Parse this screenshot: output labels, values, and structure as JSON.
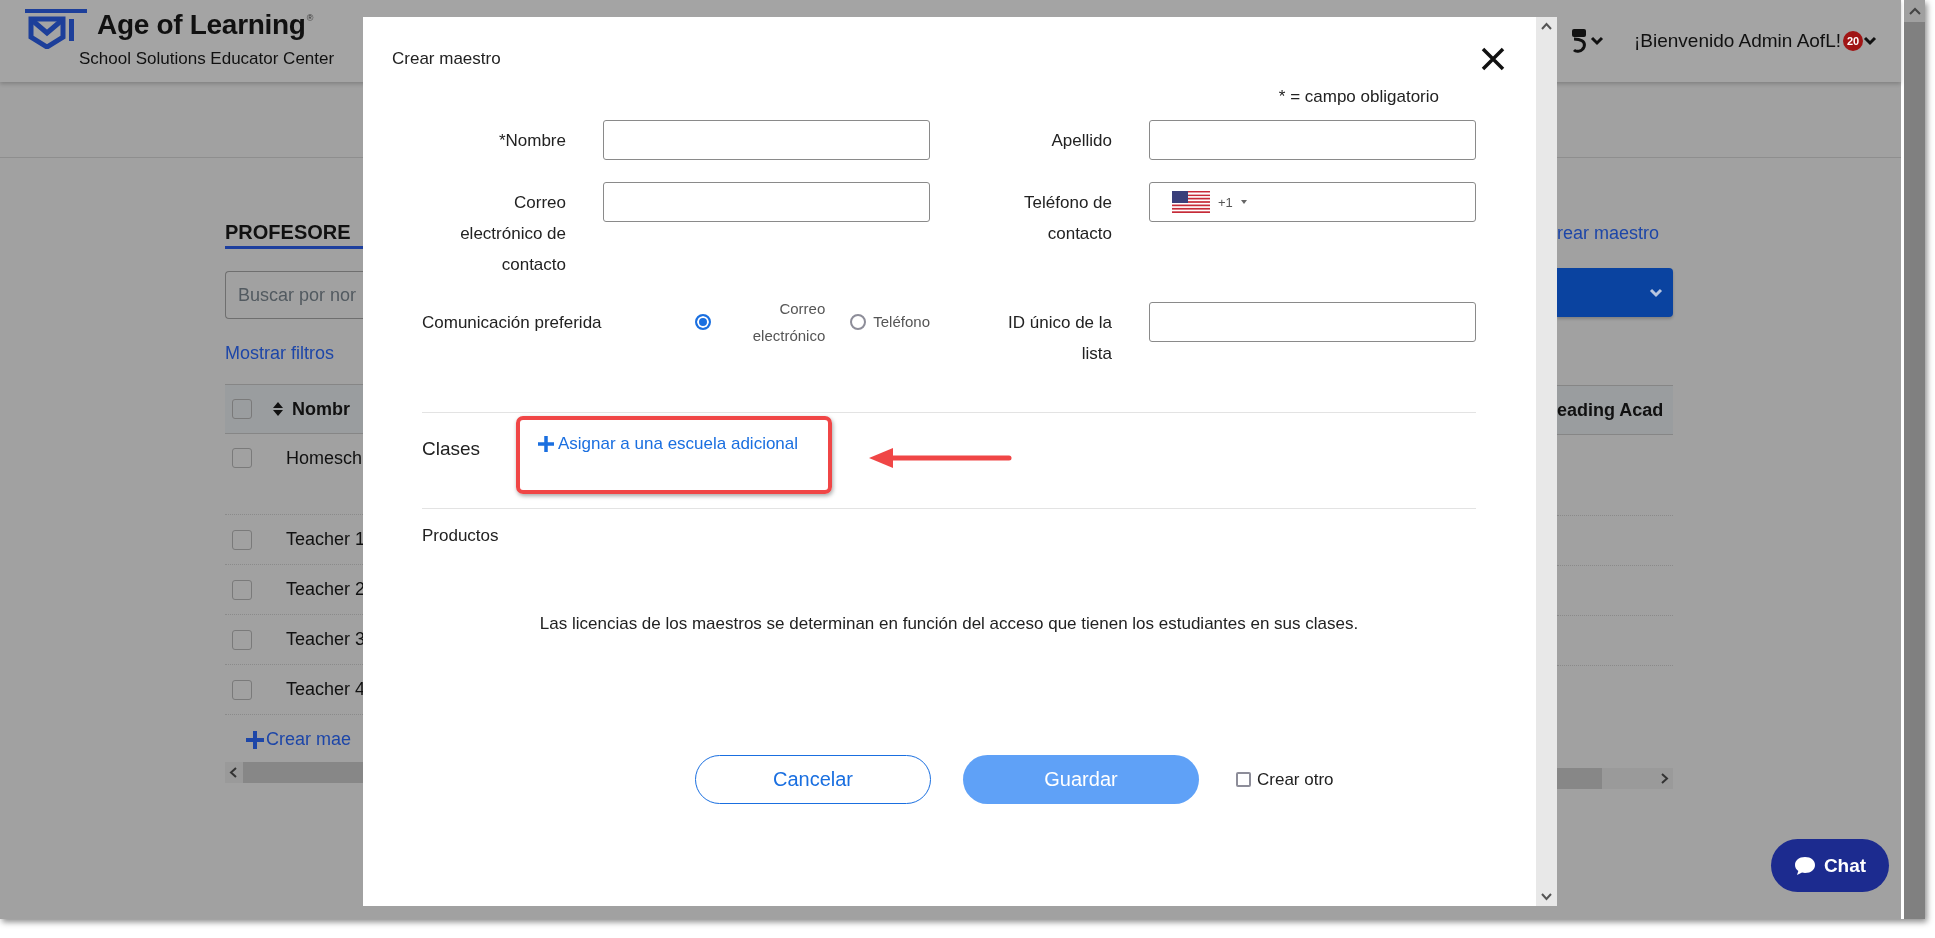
{
  "header": {
    "brand": "Age of Learning",
    "registered": "®",
    "subtitle": "School Solutions Educator Center",
    "welcome": "¡Bienvenido Admin AofL!",
    "notification_count": "20"
  },
  "page": {
    "heading": "PROFESORE",
    "search_placeholder": "Buscar por nor",
    "filters_link": "Mostrar filtros",
    "create_link_top": "rear maestro",
    "select_all": {
      "checked": false
    },
    "columns": [
      {
        "label": "Nombr"
      },
      {
        "label": "eading Acad"
      }
    ],
    "rows": [
      {
        "name": "Homesch",
        "checked": false
      },
      {
        "name": "Teacher 1",
        "checked": false
      },
      {
        "name": "Teacher 2",
        "checked": false
      },
      {
        "name": "Teacher 3",
        "checked": false
      },
      {
        "name": "Teacher 4",
        "checked": false
      }
    ],
    "create_link_bottom": "Crear mae"
  },
  "dialog": {
    "title": "Crear maestro",
    "required_note": "* = campo obligatorio",
    "fields": [
      {
        "kind": "text",
        "label": "*Nombre"
      },
      {
        "kind": "text",
        "label": "Apellido"
      },
      {
        "kind": "text",
        "label": "Correo electrónico de contacto"
      },
      {
        "kind": "phone",
        "label": "Teléfono de contacto",
        "dial_code": "+1"
      },
      {
        "kind": "radio",
        "label": "Comunicación preferida",
        "options": [
          {
            "label": "Correo electrónico",
            "selected": true
          },
          {
            "label": "Teléfono",
            "selected": false
          }
        ]
      },
      {
        "kind": "text",
        "label": "ID único de la lista"
      }
    ],
    "classes": {
      "label": "Clases",
      "link": "Asignar a una escuela adicional",
      "highlighted": true,
      "arrow": true
    },
    "products": {
      "label": "Productos",
      "note": "Las licencias de los maestros se determinan en función del acceso que tienen los estudiantes en sus clases."
    },
    "buttons": [
      {
        "label": "Cancelar",
        "kind": "secondary"
      },
      {
        "label": "Guardar",
        "kind": "primary"
      }
    ],
    "create_another": {
      "label": "Crear otro",
      "checked": false
    }
  },
  "chat": {
    "label": "Chat"
  }
}
